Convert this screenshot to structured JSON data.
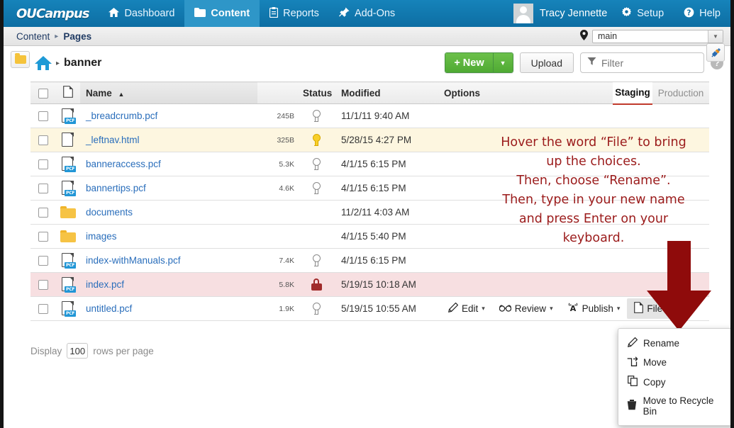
{
  "topnav": {
    "logo": "OUCampus",
    "logo_tm": "™",
    "items": [
      {
        "label": "Dashboard",
        "icon": "home-icon",
        "active": false
      },
      {
        "label": "Content",
        "icon": "folder-icon",
        "active": true
      },
      {
        "label": "Reports",
        "icon": "clipboard-icon",
        "active": false
      },
      {
        "label": "Add-Ons",
        "icon": "pin-icon",
        "active": false
      }
    ],
    "user_name": "Tracy Jennette",
    "setup_label": "Setup",
    "help_label": "Help",
    "accent_color": "#1683ba"
  },
  "breadcrumb": {
    "items": [
      "Content",
      "Pages"
    ],
    "separator": "▸",
    "site_selector_value": "main",
    "site_selector_icon": "location-pin-icon"
  },
  "toolbar": {
    "folder_button_icon": "folder-icon",
    "home_icon": "home-icon",
    "path_separator": "▸",
    "current_folder": "banner",
    "new_label": "New",
    "new_plus": "+",
    "upload_label": "Upload",
    "filter_placeholder": "Filter",
    "filter_value": "",
    "help_label": "?",
    "plug_icon": "plug-icon",
    "new_color": "#5cb33f"
  },
  "table": {
    "columns": {
      "name": "Name",
      "sort_indicator": "▲",
      "status": "Status",
      "modified": "Modified",
      "options": "Options"
    },
    "view_tabs": [
      {
        "label": "Staging",
        "active": true
      },
      {
        "label": "Production",
        "active": false
      }
    ],
    "active_tab_underline": "#c0392b",
    "rows": [
      {
        "name": "_breadcrumb.pcf",
        "icon": "pcf-file-icon",
        "size": "245B",
        "status": "bulb-off-icon",
        "modified": "11/1/11 9:40 AM",
        "highlight": "none"
      },
      {
        "name": "_leftnav.html",
        "icon": "html-file-icon",
        "size": "325B",
        "status": "bulb-on-icon",
        "modified": "5/28/15 4:27 PM",
        "highlight": "yellow"
      },
      {
        "name": "banneraccess.pcf",
        "icon": "pcf-file-icon",
        "size": "5.3K",
        "status": "bulb-off-icon",
        "modified": "4/1/15 6:15 PM",
        "highlight": "none"
      },
      {
        "name": "bannertips.pcf",
        "icon": "pcf-file-icon",
        "size": "4.6K",
        "status": "bulb-off-icon",
        "modified": "4/1/15 6:15 PM",
        "highlight": "none"
      },
      {
        "name": "documents",
        "icon": "folder-icon",
        "size": "",
        "status": "none",
        "modified": "11/2/11 4:03 AM",
        "highlight": "none"
      },
      {
        "name": "images",
        "icon": "folder-icon",
        "size": "",
        "status": "none",
        "modified": "4/1/15 5:40 PM",
        "highlight": "none"
      },
      {
        "name": "index-withManuals.pcf",
        "icon": "pcf-file-icon",
        "size": "7.4K",
        "status": "bulb-off-icon",
        "modified": "4/1/15 6:15 PM",
        "highlight": "none"
      },
      {
        "name": "index.pcf",
        "icon": "pcf-file-icon",
        "size": "5.8K",
        "status": "lock-icon",
        "modified": "5/19/15 10:18 AM",
        "highlight": "pink"
      },
      {
        "name": "untitled.pcf",
        "icon": "pcf-file-icon",
        "size": "1.9K",
        "status": "bulb-off-icon",
        "modified": "5/19/15 10:55 AM",
        "highlight": "none"
      }
    ],
    "row_options": [
      {
        "label": "Edit",
        "icon": "pencil-icon",
        "caret": "▾",
        "open": false
      },
      {
        "label": "Review",
        "icon": "glasses-icon",
        "caret": "▾",
        "open": false
      },
      {
        "label": "Publish",
        "icon": "broadcast-icon",
        "caret": "▾",
        "open": false
      },
      {
        "label": "File",
        "icon": "page-icon",
        "caret": "▾",
        "open": true
      }
    ]
  },
  "file_menu": {
    "items": [
      {
        "label": "Rename",
        "icon": "pencil-icon"
      },
      {
        "label": "Move",
        "icon": "move-arrow-icon"
      },
      {
        "label": "Copy",
        "icon": "copy-icon"
      },
      {
        "label": "Move to Recycle Bin",
        "icon": "trash-icon"
      }
    ]
  },
  "footer": {
    "display_label": "Display",
    "rows_value": "100",
    "rows_suffix": "rows per page"
  },
  "annotation": {
    "color": "#9b1b1b",
    "lines": [
      "Hover the word “File” to bring",
      "up the choices.",
      "Then, choose “Rename”.",
      "Then, type in your new name",
      "and press Enter on your",
      "keyboard."
    ],
    "arrow_icon": "down-arrow-annotation"
  }
}
